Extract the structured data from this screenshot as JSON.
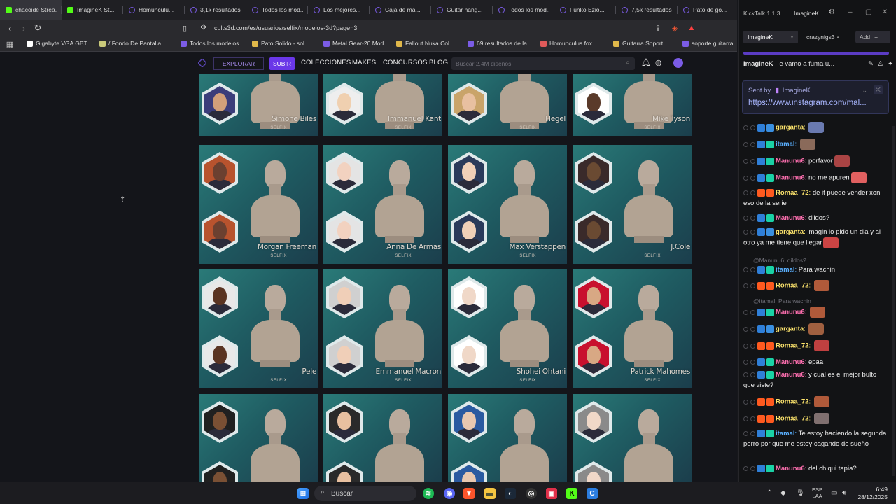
{
  "browser": {
    "tabs": [
      {
        "label": "chacoide Strea...",
        "icon": "kick-icon",
        "color": "#53fc18"
      },
      {
        "label": "ImagineK St...",
        "icon": "kick-icon",
        "color": "#53fc18"
      },
      {
        "label": "Homunculu...",
        "icon": "cults-icon",
        "color": "#7b5ce6"
      },
      {
        "label": "3,1k resultados",
        "icon": "cults-icon",
        "color": "#7b5ce6"
      },
      {
        "label": "Todos los mod...",
        "icon": "cults-icon",
        "color": "#7b5ce6"
      },
      {
        "label": "Los mejores...",
        "icon": "cults-icon",
        "color": "#7b5ce6"
      },
      {
        "label": "Caja de ma...",
        "icon": "cults-icon",
        "color": "#7b5ce6"
      },
      {
        "label": "Guitar hang...",
        "icon": "cults-icon",
        "color": "#7b5ce6"
      },
      {
        "label": "Todos los mod...",
        "icon": "cults-icon",
        "color": "#7b5ce6"
      },
      {
        "label": "Funko Ezio...",
        "icon": "cults-icon",
        "color": "#7b5ce6"
      },
      {
        "label": "7,5k resultados",
        "icon": "cults-icon",
        "color": "#7b5ce6"
      },
      {
        "label": "Pato de go...",
        "icon": "cults-icon",
        "color": "#7b5ce6"
      }
    ],
    "url": "cults3d.com/es/usuarios/selfix/modelos-3d?page=3",
    "bookmarks": [
      "Gigabyte VGA GBT...",
      "/ Fondo De Pantalla...",
      "Todos los modelos...",
      "Pato Solido - sol...",
      "Metal Gear-20 Mod...",
      "Fallout Nuka Col...",
      "69 resultados de la...",
      "Homunculus fox...",
      "Guitarra Soport...",
      "soporte guitarra..."
    ]
  },
  "site": {
    "explorar": "EXPLORAR",
    "subir": "SUBIR",
    "colecciones": "COLECCIONES",
    "makes": "MAKES",
    "concursos": "CONCURSOS",
    "blog": "BLOG",
    "search_placeholder": "Buscar 2,4M diseños"
  },
  "cards": [
    {
      "name": "Simone Biles",
      "brand": "SELFIX"
    },
    {
      "name": "Immanuel Kant",
      "brand": "SELFIX"
    },
    {
      "name": "Hegel",
      "brand": "SELFIX"
    },
    {
      "name": "Mike Tyson",
      "brand": "SELFIX"
    },
    {
      "name": "Morgan Freeman",
      "brand": "SELFIX"
    },
    {
      "name": "Anna De Armas",
      "brand": "SELFIX"
    },
    {
      "name": "Max Verstappen",
      "brand": "SELFIX"
    },
    {
      "name": "J.Cole",
      "brand": "SELFIX"
    },
    {
      "name": "Pele",
      "brand": "SELFIX"
    },
    {
      "name": "Emmanuel Macron",
      "brand": "SELFIX"
    },
    {
      "name": "Shohei Ohtani",
      "brand": "SELFIX"
    },
    {
      "name": "Patrick Mahomes",
      "brand": "SELFIX"
    },
    {
      "name": "",
      "brand": ""
    },
    {
      "name": "",
      "brand": ""
    },
    {
      "name": "",
      "brand": ""
    },
    {
      "name": "",
      "brand": ""
    }
  ],
  "kicktalk": {
    "title": "KickTalk 1.1.3",
    "user": "ImagineK",
    "tab_active": "ImagineK",
    "tab_other": "crazynigs3",
    "add": "Add",
    "header_user": "ImagineK",
    "header_text": "e vamo a fuma u...",
    "sent_by_label": "Sent by",
    "sent_by_user": "ImagineK",
    "link": "https://www.instagram.com/mal...",
    "messages": [
      {
        "user": "garganta",
        "color": "#ffe66d",
        "text": ""
      },
      {
        "user": "itamal",
        "color": "#5ab0ff",
        "text": ""
      },
      {
        "user": "Manunu6",
        "color": "#ff6fb0",
        "text": "porfavor"
      },
      {
        "user": "Manunu6",
        "color": "#ff6fb0",
        "text": "no me apuren"
      },
      {
        "user": "Romaa_72",
        "color": "#ffe66d",
        "text": "de it puede vender xon eso de la serie"
      },
      {
        "user": "Manunu6",
        "color": "#ff6fb0",
        "text": "dildos?"
      },
      {
        "user": "garganta",
        "color": "#ffe66d",
        "text": "imagin lo pido un dia y al otro ya me tiene que llegar"
      },
      {
        "user": "itamal",
        "color": "#5ab0ff",
        "text": "Para wachin"
      },
      {
        "user": "Romaa_72",
        "color": "#ffe66d",
        "text": ""
      },
      {
        "user": "Manunu6",
        "color": "#ff6fb0",
        "text": ""
      },
      {
        "user": "garganta",
        "color": "#ffe66d",
        "text": ""
      },
      {
        "user": "Romaa_72",
        "color": "#ffe66d",
        "text": ""
      },
      {
        "user": "Manunu6",
        "color": "#ff6fb0",
        "text": "epaa"
      },
      {
        "user": "Manunu6",
        "color": "#ff6fb0",
        "text": "y cual es el mejor bulto que viste?"
      },
      {
        "user": "Romaa_72",
        "color": "#ffe66d",
        "text": ""
      },
      {
        "user": "Romaa_72",
        "color": "#ffe66d",
        "text": ""
      },
      {
        "user": "itamal",
        "color": "#5ab0ff",
        "text": "Te estoy haciendo la segunda perro por que me estoy cagando de sueño"
      },
      {
        "user": "Manunu6",
        "color": "#ff6fb0",
        "text": "del chiqui tapia?"
      }
    ],
    "reply1": "@Manunu6: dildos?",
    "reply2": "@itamal: Para wachin"
  },
  "taskbar": {
    "search": "Buscar",
    "lang": "ESP",
    "lang2": "LAA",
    "time": "6:49",
    "date": "28/12/2025"
  }
}
